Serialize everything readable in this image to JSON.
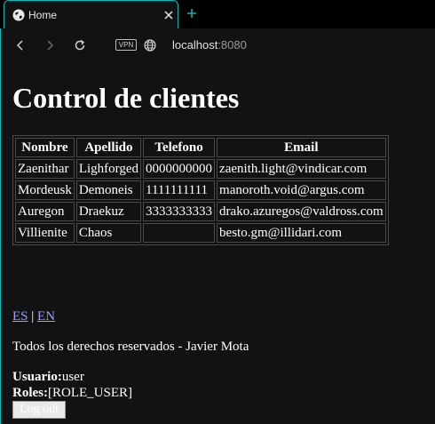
{
  "browser": {
    "tab": {
      "title": "Home"
    },
    "address": {
      "host": "localhost",
      "port": ":8080"
    },
    "vpn_badge": "VPN"
  },
  "page": {
    "heading": "Control de clientes",
    "table": {
      "headers": [
        "Nombre",
        "Apellido",
        "Telefono",
        "Email"
      ],
      "rows": [
        [
          "Zaenithar",
          "Lighforged",
          "0000000000",
          "zaenith.light@vindicar.com"
        ],
        [
          "Mordeusk",
          "Demoneis",
          "1111111111",
          "manoroth.void@argus.com"
        ],
        [
          "Auregon",
          "Draekuz",
          "3333333333",
          "drako.azuregos@valdross.com"
        ],
        [
          "Villienite",
          "Chaos",
          "",
          "besto.gm@illidari.com"
        ]
      ]
    },
    "lang": {
      "es": "ES",
      "separator": " | ",
      "en": "EN"
    },
    "footer": {
      "rights": "Todos los derechos reservados - Javier Mota",
      "user_label": "Usuario:",
      "user_value": "user",
      "roles_label": "Roles:",
      "roles_value": "[ROLE_USER]",
      "logout_label": "Log out"
    }
  }
}
